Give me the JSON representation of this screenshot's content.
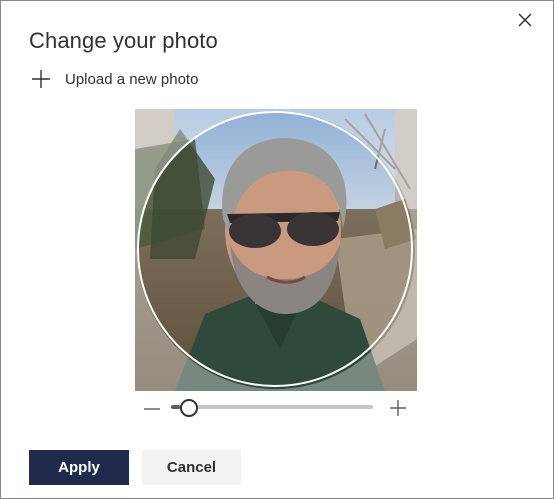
{
  "dialog": {
    "title": "Change your photo",
    "upload_label": "Upload a new photo",
    "apply_label": "Apply",
    "cancel_label": "Cancel"
  },
  "zoom": {
    "level": 0.05
  },
  "icons": {
    "close": "close-icon",
    "upload": "plus-icon",
    "zoom_out": "minus-icon",
    "zoom_in": "plus-icon"
  },
  "colors": {
    "primary_button": "#1f2a4d",
    "secondary_button": "#f3f2f1"
  }
}
